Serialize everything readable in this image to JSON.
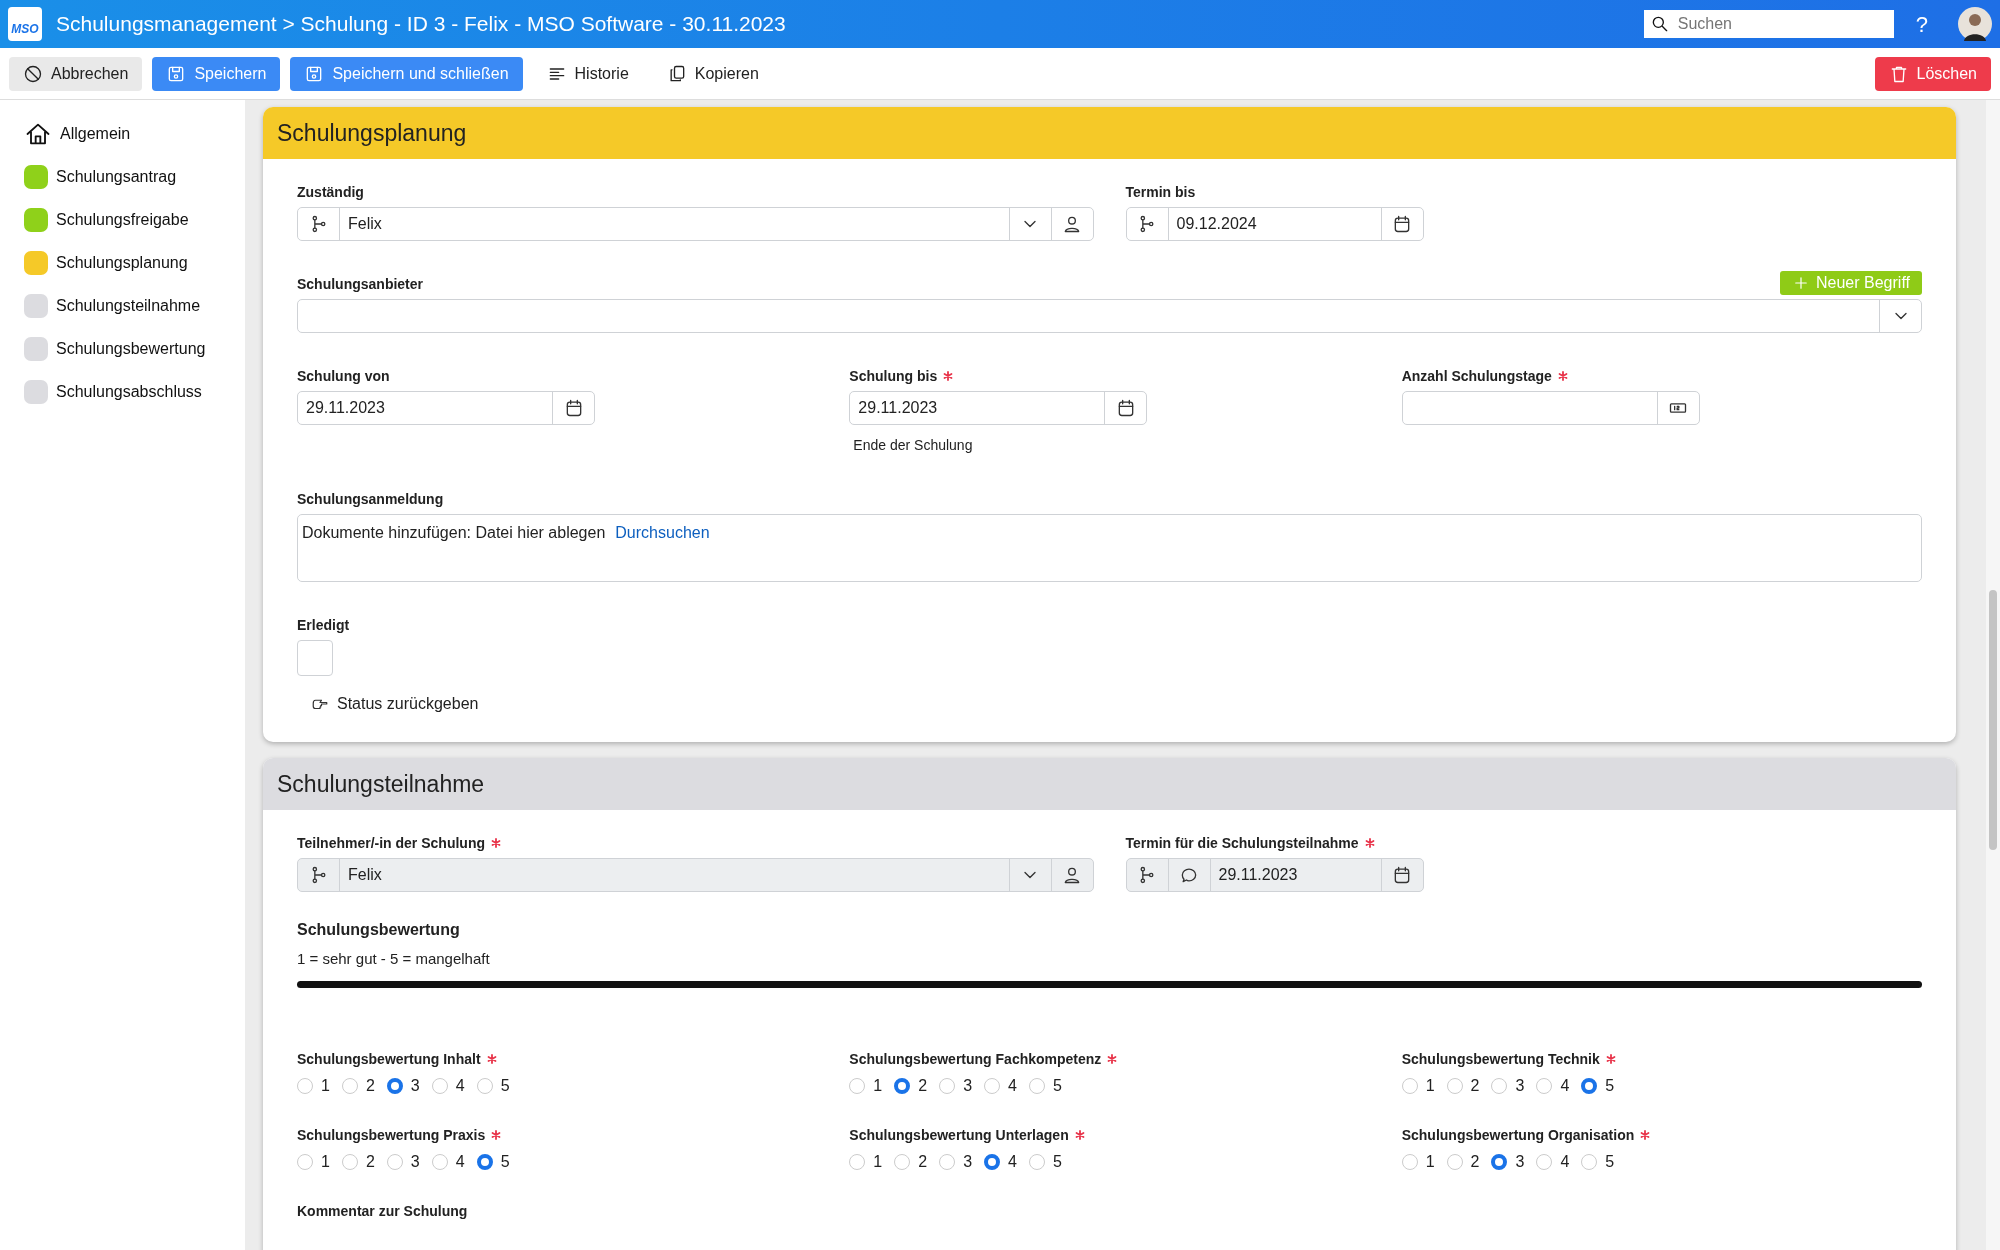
{
  "window": {
    "title": "Schulungsmanagement > Schulung - ID 3 - Felix - MSO Software - 30.11.2023",
    "logo": "MSO"
  },
  "search": {
    "placeholder": "Suchen"
  },
  "help": "?",
  "toolbar": [
    {
      "label": "Abbrechen",
      "kind": "cancel"
    },
    {
      "label": "Speichern",
      "kind": "save"
    },
    {
      "label": "Speichern und schließen",
      "kind": "save"
    },
    {
      "label": "Historie",
      "kind": "history"
    },
    {
      "label": "Kopieren",
      "kind": "copy"
    }
  ],
  "delete_button": "Löschen",
  "sidebar": {
    "items": [
      {
        "label": "Allgemein",
        "kind": "home"
      },
      {
        "label": "Schulungsantrag",
        "kind": "status",
        "color": "#8fd11a"
      },
      {
        "label": "Schulungsfreigabe",
        "kind": "status",
        "color": "#8fd11a"
      },
      {
        "label": "Schulungsplanung",
        "kind": "status",
        "color": "#f5c928"
      },
      {
        "label": "Schulungsteilnahme",
        "kind": "status",
        "color": "#dcdce0"
      },
      {
        "label": "Schulungsbewertung",
        "kind": "status",
        "color": "#dcdce0"
      },
      {
        "label": "Schulungsabschluss",
        "kind": "status",
        "color": "#dcdce0"
      }
    ]
  },
  "sections": [
    {
      "title": "Schulungsplanung",
      "color": "#f5c928",
      "rows": [
        [
          {
            "kind": "person-select",
            "label": "Zuständig",
            "required": false,
            "value": "Felix",
            "disabled": false
          },
          {
            "kind": "workflow-date",
            "label": "Termin bis",
            "required": false,
            "value": "09.12.2024",
            "disabled": false
          }
        ],
        [
          {
            "kind": "select",
            "label": "Schulungsanbieter",
            "required": false,
            "action": "Neuer Begriff"
          }
        ],
        [
          {
            "kind": "date",
            "label": "Schulung von",
            "required": false,
            "value": "29.11.2023"
          },
          {
            "kind": "date",
            "label": "Schulung bis",
            "required": true,
            "value": "29.11.2023",
            "hint": "Ende der Schulung"
          },
          {
            "kind": "number",
            "label": "Anzahl Schulungstage",
            "required": true
          }
        ],
        [
          {
            "kind": "upload",
            "label": "Schulungsanmeldung",
            "required": false,
            "text": "Dokumente hinzufügen: Datei hier ablegen",
            "link": "Durchsuchen"
          }
        ],
        [
          {
            "kind": "checkbox",
            "label": "Erledigt",
            "required": false,
            "checked": false,
            "action": "Status zurückgeben"
          }
        ]
      ]
    },
    {
      "title": "Schulungsteilnahme",
      "color": "#dcdce0",
      "rows": [
        [
          {
            "kind": "person-select",
            "label": "Teilnehmer/-in der Schulung",
            "required": true,
            "value": "Felix",
            "disabled": true
          },
          {
            "kind": "workflow-comment-date",
            "label": "Termin für die Schulungsteilnahme",
            "required": true,
            "value": "29.11.2023",
            "disabled": true
          }
        ],
        [
          {
            "kind": "heading",
            "label": "Schulungsbewertung",
            "text": "1 = sehr gut - 5 = mangelhaft"
          }
        ],
        [
          {
            "kind": "rating",
            "label": "Schulungsbewertung Inhalt",
            "required": true,
            "options": [
              {
                "label": "1",
                "selected": false
              },
              {
                "label": "2",
                "selected": false
              },
              {
                "label": "3",
                "selected": true
              },
              {
                "label": "4",
                "selected": false
              },
              {
                "label": "5",
                "selected": false
              }
            ]
          },
          {
            "kind": "rating",
            "label": "Schulungsbewertung Fachkompetenz",
            "required": true,
            "options": [
              {
                "label": "1",
                "selected": false
              },
              {
                "label": "2",
                "selected": true
              },
              {
                "label": "3",
                "selected": false
              },
              {
                "label": "4",
                "selected": false
              },
              {
                "label": "5",
                "selected": false
              }
            ]
          },
          {
            "kind": "rating",
            "label": "Schulungsbewertung Technik",
            "required": true,
            "options": [
              {
                "label": "1",
                "selected": false
              },
              {
                "label": "2",
                "selected": false
              },
              {
                "label": "3",
                "selected": false
              },
              {
                "label": "4",
                "selected": false
              },
              {
                "label": "5",
                "selected": true
              }
            ]
          }
        ],
        [
          {
            "kind": "rating",
            "label": "Schulungsbewertung Praxis",
            "required": true,
            "options": [
              {
                "label": "1",
                "selected": false
              },
              {
                "label": "2",
                "selected": false
              },
              {
                "label": "3",
                "selected": false
              },
              {
                "label": "4",
                "selected": false
              },
              {
                "label": "5",
                "selected": true
              }
            ]
          },
          {
            "kind": "rating",
            "label": "Schulungsbewertung Unterlagen",
            "required": true,
            "options": [
              {
                "label": "1",
                "selected": false
              },
              {
                "label": "2",
                "selected": false
              },
              {
                "label": "3",
                "selected": false
              },
              {
                "label": "4",
                "selected": true
              },
              {
                "label": "5",
                "selected": false
              }
            ]
          },
          {
            "kind": "rating",
            "label": "Schulungsbewertung Organisation",
            "required": true,
            "options": [
              {
                "label": "1",
                "selected": false
              },
              {
                "label": "2",
                "selected": false
              },
              {
                "label": "3",
                "selected": true
              },
              {
                "label": "4",
                "selected": false
              },
              {
                "label": "5",
                "selected": false
              }
            ]
          }
        ],
        [
          {
            "kind": "label-only",
            "label": "Kommentar zur Schulung",
            "required": false
          }
        ]
      ]
    }
  ]
}
